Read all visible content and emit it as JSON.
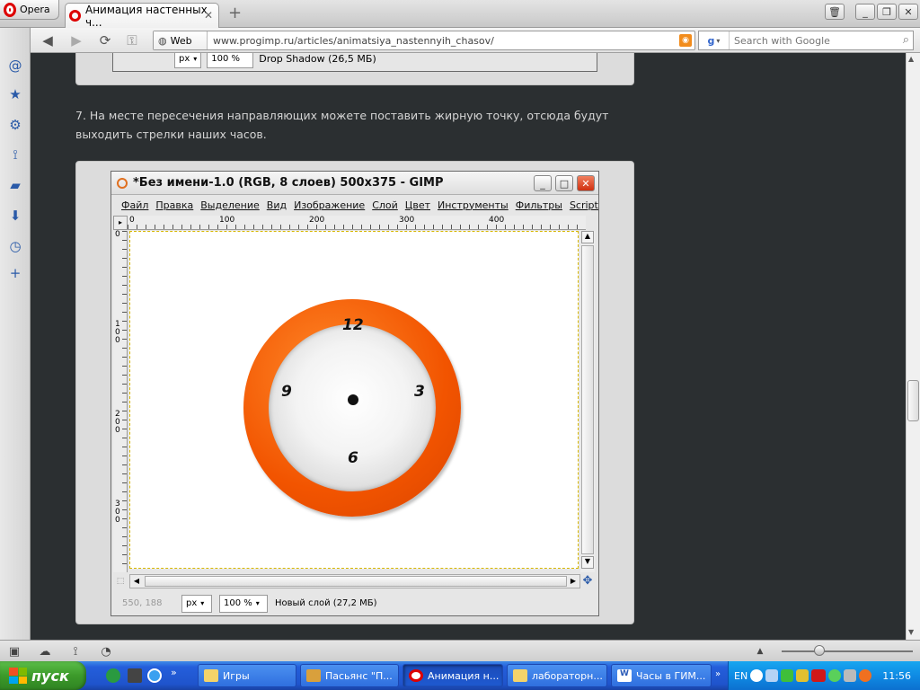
{
  "browser": {
    "menu_label": "Opera",
    "tab_title": "Анимация настенных ч...",
    "tab_close": "✕",
    "new_tab": "+",
    "address_badge": "Web",
    "url": "www.progimp.ru/articles/animatsiya_nastennyih_chasov/",
    "search_placeholder": "Search with Google"
  },
  "page": {
    "prev_screenshot": {
      "unit": "px",
      "zoom": "100 %",
      "layer_info": "Drop Shadow (26,5 МБ)"
    },
    "step_text": "7. На месте пересечения направляющих можете поставить жирную точку, отсюда будут выходить стрелки наших часов."
  },
  "gimp": {
    "title": "*Без имени-1.0 (RGB, 8 слоев) 500x375 - GIMP",
    "menu": [
      "Файл",
      "Правка",
      "Выделение",
      "Вид",
      "Изображение",
      "Слой",
      "Цвет",
      "Инструменты",
      "Фильтры",
      "Script-"
    ],
    "ruler_h": [
      "0",
      "100",
      "200",
      "300",
      "400"
    ],
    "ruler_v": [
      "0",
      "1\n0\n0",
      "2\n0\n0",
      "3\n0\n0"
    ],
    "status": {
      "coords": "550, 188",
      "unit": "px",
      "zoom": "100 %",
      "layer_info": "Новый слой (27,2 МБ)"
    },
    "clock": {
      "numbers": {
        "n12": "12",
        "n3": "3",
        "n6": "6",
        "n9": "9"
      },
      "ring_color": "#f25400"
    }
  },
  "taskbar": {
    "start_label": "пуск",
    "buttons": [
      {
        "label": "Игры"
      },
      {
        "label": "Пасьянс \"П..."
      },
      {
        "label": "Анимация н..."
      },
      {
        "label": "лабораторн..."
      },
      {
        "label": "Часы в ГИМ..."
      }
    ],
    "language": "EN",
    "time": "11:56"
  }
}
